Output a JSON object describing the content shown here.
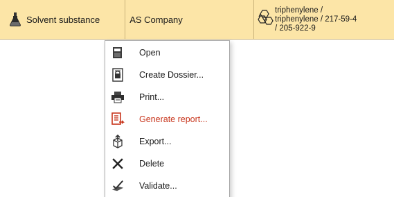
{
  "row": {
    "type_label": "Solvent substance",
    "owner": "AS Company",
    "reference_lines": [
      "triphenylene /",
      "triphenylene / 217-59-4",
      "/ 205-922-9"
    ],
    "type_icon": "flask-icon",
    "structure_icon": "chemical-structure-icon"
  },
  "context_menu": {
    "items": [
      {
        "label": "Open",
        "icon": "open-folder-icon"
      },
      {
        "label": "Create Dossier...",
        "icon": "dossier-icon"
      },
      {
        "label": "Print...",
        "icon": "printer-icon"
      },
      {
        "label": "Generate report...",
        "icon": "report-icon",
        "highlighted": true
      },
      {
        "label": "Export...",
        "icon": "export-icon"
      },
      {
        "label": "Delete",
        "icon": "delete-icon"
      },
      {
        "label": "Validate...",
        "icon": "validate-icon"
      }
    ]
  },
  "colors": {
    "row_highlight": "#fce5a7",
    "highlight_text": "#c8361d",
    "menu_border": "#a8a8a8"
  }
}
